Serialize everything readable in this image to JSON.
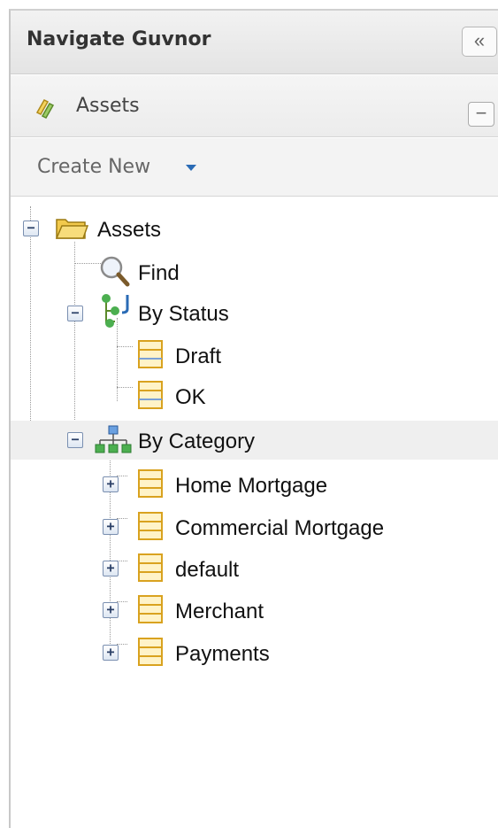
{
  "panel": {
    "title": "Navigate Guvnor",
    "collapse_glyph": "«"
  },
  "assets_section": {
    "label": "Assets",
    "icon": "rules-icon",
    "minimize_glyph": "−"
  },
  "create_new": {
    "label": "Create New"
  },
  "tree": {
    "root": {
      "label": "Assets",
      "toggle": "−",
      "icon": "folder-open-icon"
    },
    "find": {
      "label": "Find",
      "icon": "magnifier-icon"
    },
    "by_status": {
      "label": "By Status",
      "toggle": "−",
      "icon": "status-tree-icon",
      "children": [
        {
          "label": "Draft",
          "icon": "package-icon"
        },
        {
          "label": "OK",
          "icon": "package-icon"
        }
      ]
    },
    "by_category": {
      "label": "By Category",
      "toggle": "−",
      "icon": "category-tree-icon",
      "children": [
        {
          "label": "Home Mortgage",
          "toggle": "+",
          "icon": "package-icon"
        },
        {
          "label": "Commercial Mortgage",
          "toggle": "+",
          "icon": "package-icon"
        },
        {
          "label": "default",
          "toggle": "+",
          "icon": "package-icon"
        },
        {
          "label": "Merchant",
          "toggle": "+",
          "icon": "package-icon"
        },
        {
          "label": "Payments",
          "toggle": "+",
          "icon": "package-icon"
        }
      ]
    }
  },
  "colors": {
    "caret": "#2a6bb5",
    "folder": "#f2c94c",
    "package": "#e8b84a",
    "selected_row": "#efefef"
  }
}
